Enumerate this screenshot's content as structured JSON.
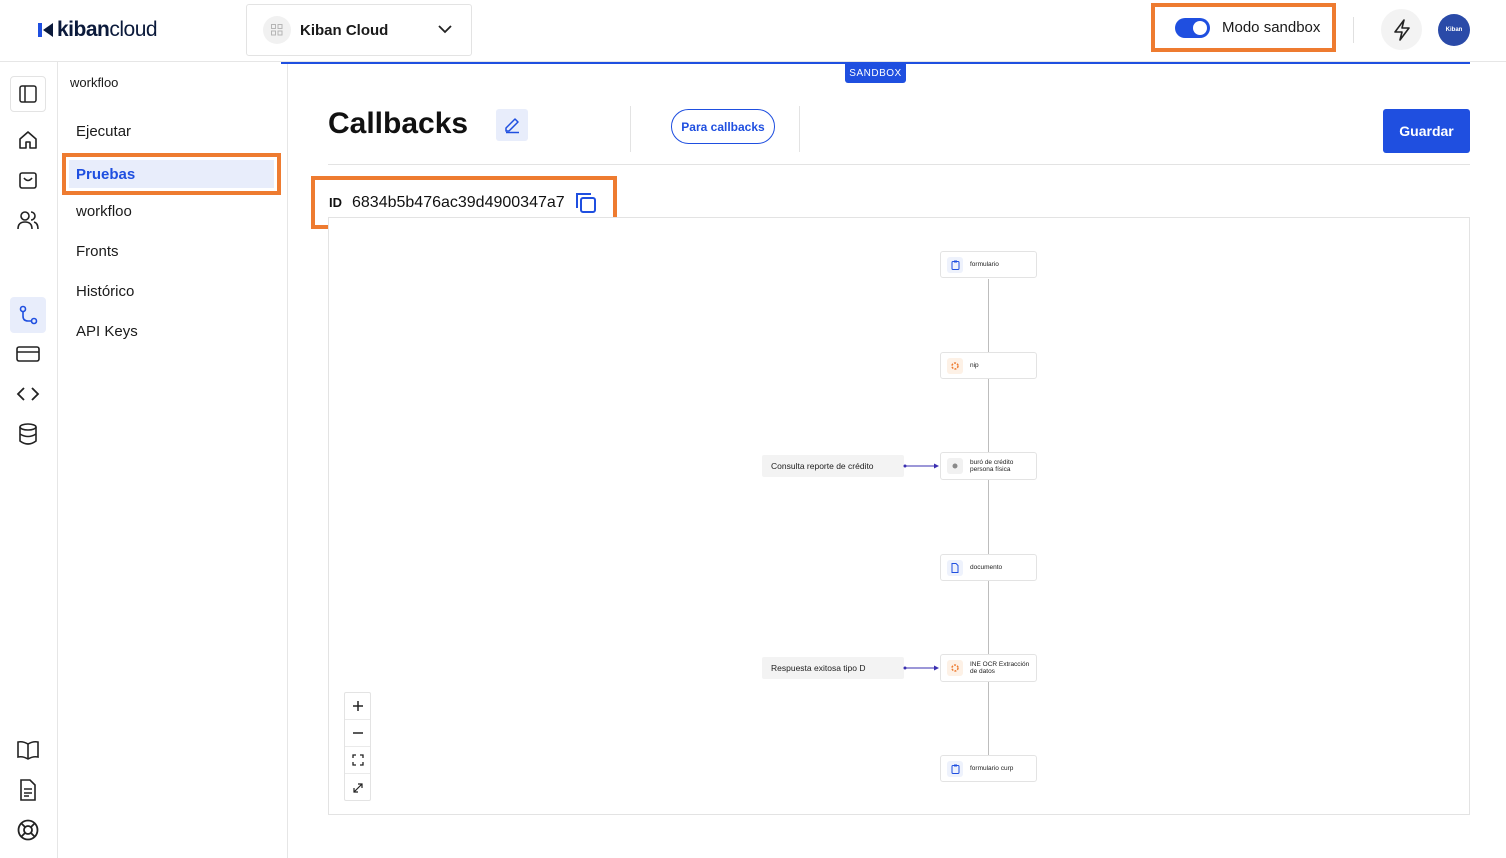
{
  "logo": {
    "bold": "kiban",
    "light": "cloud"
  },
  "org_selector": {
    "value": "Kiban Cloud",
    "icon": "grid-icon"
  },
  "sandbox_toggle": {
    "label": "Modo sandbox",
    "enabled": true
  },
  "avatar": {
    "text": "Kiban"
  },
  "rail": {
    "items": [
      "sidebar-toggle-icon",
      "home-icon",
      "shopping-bag-icon",
      "users-icon",
      "workflow-icon",
      "credit-card-icon",
      "code-icon",
      "database-icon",
      "book-icon",
      "document-icon",
      "lifebuoy-icon"
    ],
    "active": "workflow-icon"
  },
  "subnav": {
    "title": "workfloo",
    "items": [
      {
        "label": "Ejecutar"
      },
      {
        "label": "Pruebas",
        "active": true
      },
      {
        "label": "workfloo"
      },
      {
        "label": "Fronts"
      },
      {
        "label": "Histórico"
      },
      {
        "label": "API Keys"
      }
    ]
  },
  "sandbox_tag": "SANDBOX",
  "page": {
    "title": "Callbacks",
    "pill_label": "Para callbacks",
    "save_label": "Guardar",
    "id_label": "ID",
    "id_value": "6834b5b476ac39d4900347a7"
  },
  "flow": {
    "nodes": [
      {
        "label": "formulario",
        "icon": "clipboard-icon"
      },
      {
        "label": "nip",
        "icon": "settings-icon"
      },
      {
        "label": "buró de crédito persona física",
        "icon": "bureau-icon"
      },
      {
        "label": "documento",
        "icon": "file-icon"
      },
      {
        "label": "INE OCR Extracción de datos",
        "icon": "settings-icon"
      },
      {
        "label": "formulario curp",
        "icon": "clipboard-icon"
      }
    ],
    "callbacks": [
      {
        "label": "Consulta reporte de crédito",
        "target": "buró de crédito persona física"
      },
      {
        "label": "Respuesta exitosa tipo D",
        "target": "INE OCR Extracción de datos"
      }
    ]
  },
  "colors": {
    "accent": "#1f4fe0",
    "highlight": "#ee7b30",
    "active_bg": "#e8edfb"
  }
}
